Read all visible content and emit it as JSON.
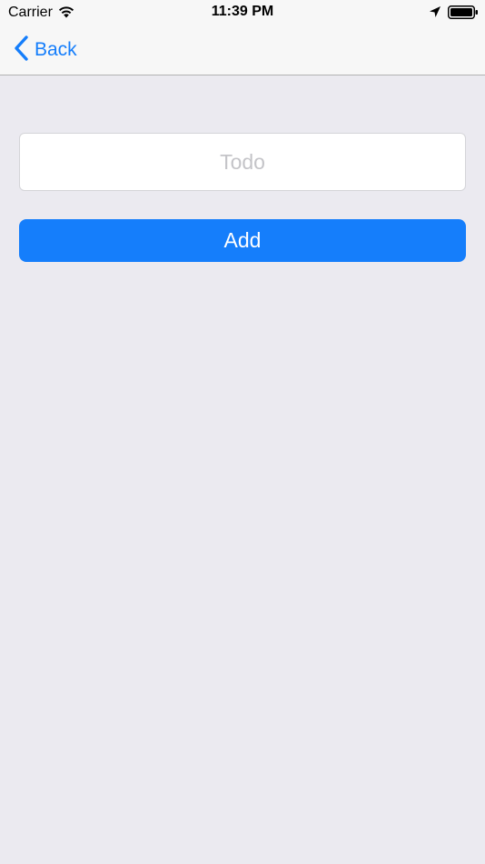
{
  "status_bar": {
    "carrier": "Carrier",
    "time": "11:39 PM",
    "icons": [
      "wifi-icon",
      "location-arrow-icon",
      "battery-icon"
    ]
  },
  "nav_bar": {
    "back_label": "Back",
    "back_icon": "chevron-left-icon"
  },
  "form": {
    "todo_value": "",
    "todo_placeholder": "Todo",
    "add_label": "Add"
  },
  "colors": {
    "accent": "#157EFB",
    "background": "#EBEAF0",
    "bar": "#F7F7F7",
    "placeholder": "#C4C4C8"
  }
}
